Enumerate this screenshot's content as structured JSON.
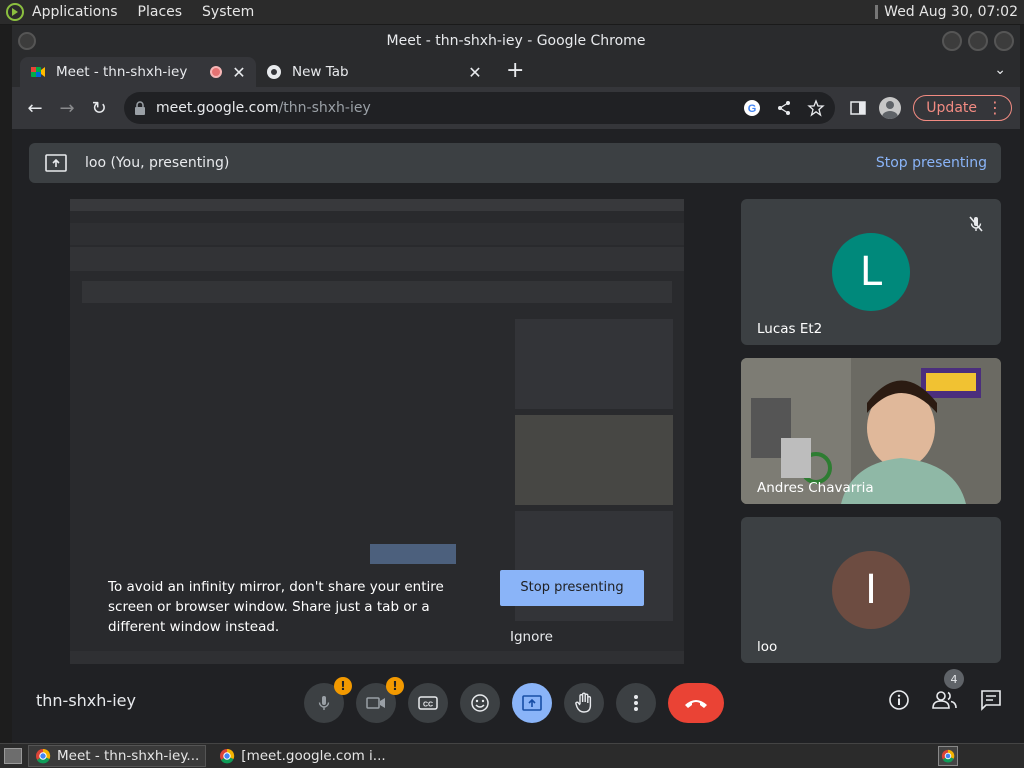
{
  "system_panel": {
    "menus": [
      "Applications",
      "Places",
      "System"
    ],
    "clock": "Wed Aug 30, 07:02"
  },
  "window": {
    "title": "Meet - thn-shxh-iey - Google Chrome"
  },
  "tabs": [
    {
      "label": "Meet - thn-shxh-iey",
      "active": true
    },
    {
      "label": "New Tab",
      "active": false
    }
  ],
  "toolbar": {
    "url_host": "meet.google.com",
    "url_path": "/thn-shxh-iey",
    "update_label": "Update"
  },
  "presenting_bar": {
    "label": "loo (You, presenting)",
    "stop_label": "Stop presenting"
  },
  "participants": [
    {
      "name": "Lucas Et2",
      "initial": "L",
      "avatar_color": "#00897b",
      "muted": true
    },
    {
      "name": "Andres Chavarria",
      "initial": "",
      "video": true
    },
    {
      "name": "loo",
      "initial": "I",
      "avatar_color": "#6d4c41"
    }
  ],
  "mirror_warning": {
    "text": "To avoid an infinity mirror, don't share your entire screen or browser window. Share just a tab or a different window instead.",
    "stop_button": "Stop presenting",
    "ignore": "Ignore"
  },
  "bottom_bar": {
    "meeting_code": "thn-shxh-iey",
    "warning_badge": "!",
    "people_count": "4"
  },
  "taskbar": {
    "tasks": [
      "Meet - thn-shxh-iey...",
      "[meet.google.com i..."
    ]
  },
  "colors": {
    "accent_blue": "#8ab4f8",
    "end_call": "#ea4335",
    "warning": "#f29900",
    "update_red": "#f28b82"
  }
}
